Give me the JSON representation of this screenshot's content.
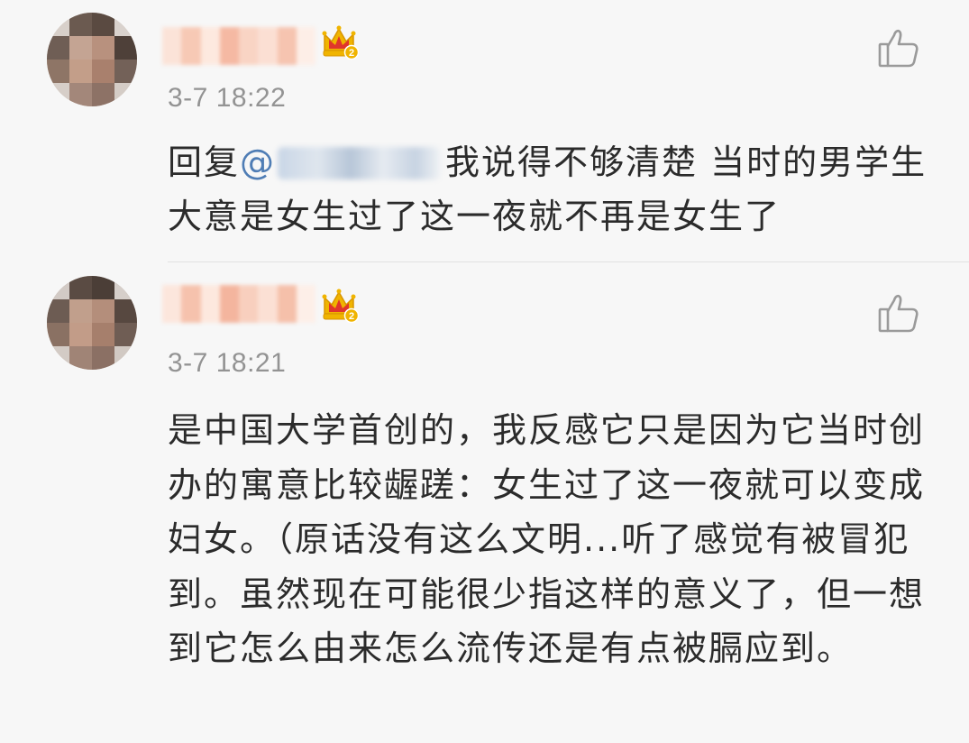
{
  "comments": [
    {
      "timestamp": "3-7 18:22",
      "reply_prefix": "回复",
      "mention_at": "@",
      "text": "我说得不够清楚 当时的男学生大意是女生过了这一夜就不再是女生了",
      "badge_number": "2"
    },
    {
      "timestamp": "3-7 18:21",
      "text": "是中国大学首创的，我反感它只是因为它当时创办的寓意比较龌蹉：女生过了这一夜就可以变成妇女。（原话没有这么文明...听了感觉有被冒犯到。虽然现在可能很少指这样的意义了，但一想到它怎么由来怎么流传还是有点被膈应到。",
      "badge_number": "2"
    }
  ],
  "icons": {
    "badge": "crown-level-badge-icon",
    "like": "thumbs-up-icon"
  },
  "colors": {
    "background": "#f7f7f7",
    "timestamp": "#939393",
    "mention": "#4f7db5",
    "crown_gold": "#f0b400",
    "crown_red": "#e0352b"
  }
}
